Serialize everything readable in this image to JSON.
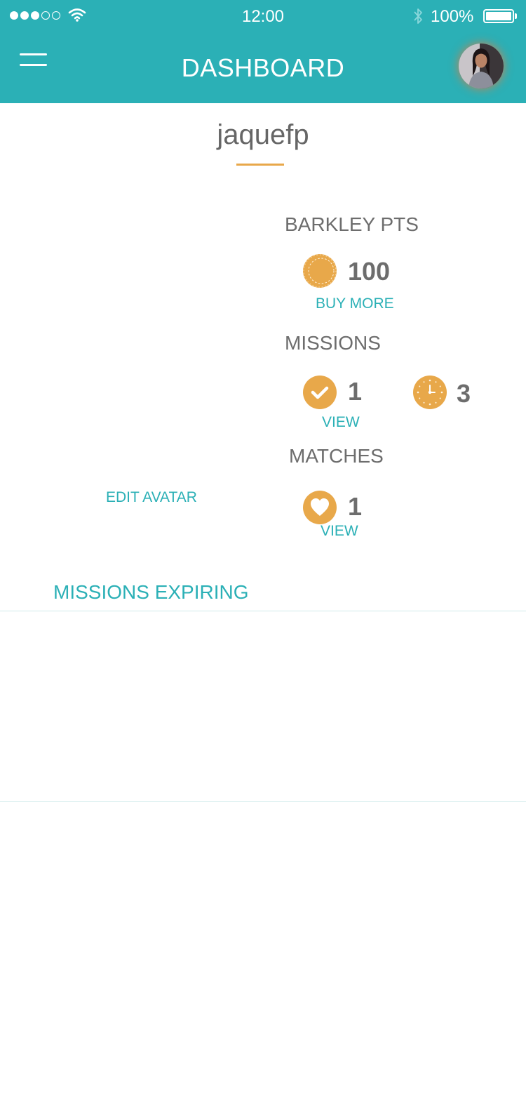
{
  "status_bar": {
    "signal_full": 3,
    "signal_total": 5,
    "time": "12:00",
    "battery": "100%"
  },
  "header": {
    "title": "DASHBOARD",
    "menu_icon": "hamburger-menu-icon",
    "avatar_icon": "user-avatar"
  },
  "profile": {
    "username": "jaquefp",
    "edit_avatar_label": "EDIT AVATAR"
  },
  "points": {
    "label": "BARKLEY PTS",
    "value": "100",
    "icon": "coin-icon",
    "action_label": "BUY MORE"
  },
  "missions": {
    "label": "MISSIONS",
    "completed_count": "1",
    "completed_icon": "check-icon",
    "pending_count": "3",
    "pending_icon": "clock-icon",
    "action_label": "VIEW"
  },
  "matches": {
    "label": "MATCHES",
    "count": "1",
    "icon": "heart-icon",
    "action_label": "VIEW"
  },
  "expiring": {
    "title": "MISSIONS EXPIRING"
  },
  "colors": {
    "primary": "#2bb0b6",
    "accent": "#e8a84a",
    "text": "#6d6d6d"
  }
}
